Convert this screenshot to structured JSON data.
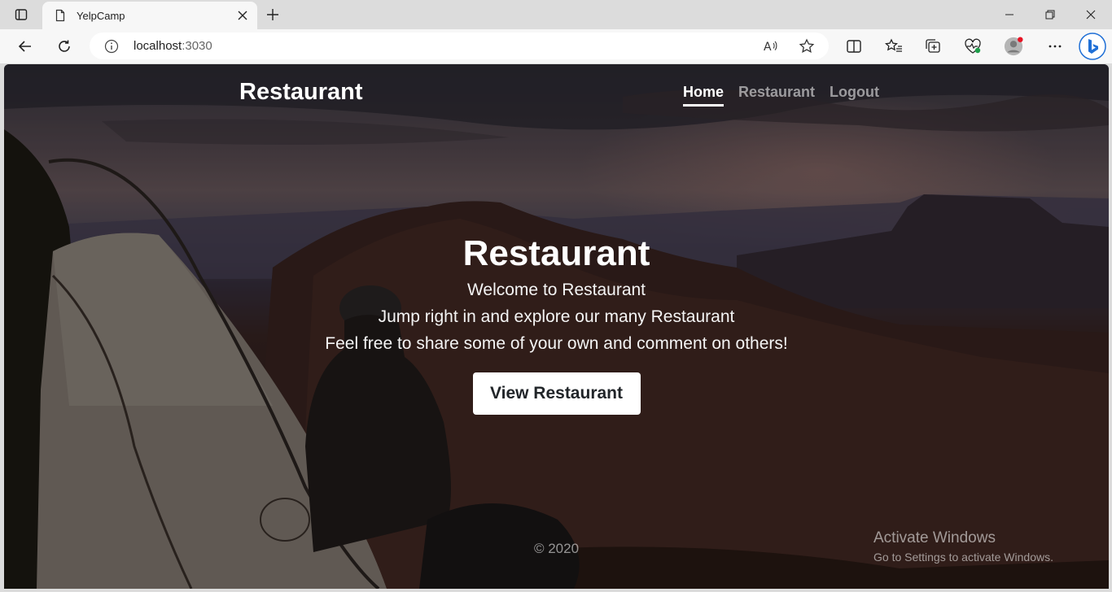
{
  "browser": {
    "tab_title": "YelpCamp",
    "url_host": "localhost",
    "url_port": ":3030"
  },
  "site": {
    "brand": "Restaurant",
    "nav": [
      {
        "label": "Home",
        "active": true
      },
      {
        "label": "Restaurant",
        "active": false
      },
      {
        "label": "Logout",
        "active": false
      }
    ]
  },
  "hero": {
    "title": "Restaurant",
    "line1": "Welcome to Restaurant",
    "line2": "Jump right in and explore our many Restaurant",
    "line3": "Feel free to share some of your own and comment on others!",
    "button": "View Restaurant"
  },
  "footer": "© 2020",
  "watermark": {
    "line1": "Activate Windows",
    "line2": "Go to Settings to activate Windows."
  },
  "icons": [
    "tab-actions-icon",
    "page-icon",
    "close-icon",
    "plus-icon",
    "minimize-icon",
    "restore-icon",
    "window-close-icon",
    "back-icon",
    "refresh-icon",
    "info-icon",
    "read-aloud-icon",
    "favorite-star-icon",
    "split-screen-icon",
    "favorites-icon",
    "collections-icon",
    "health-icon",
    "profile-icon",
    "more-icon",
    "copilot-icon"
  ]
}
